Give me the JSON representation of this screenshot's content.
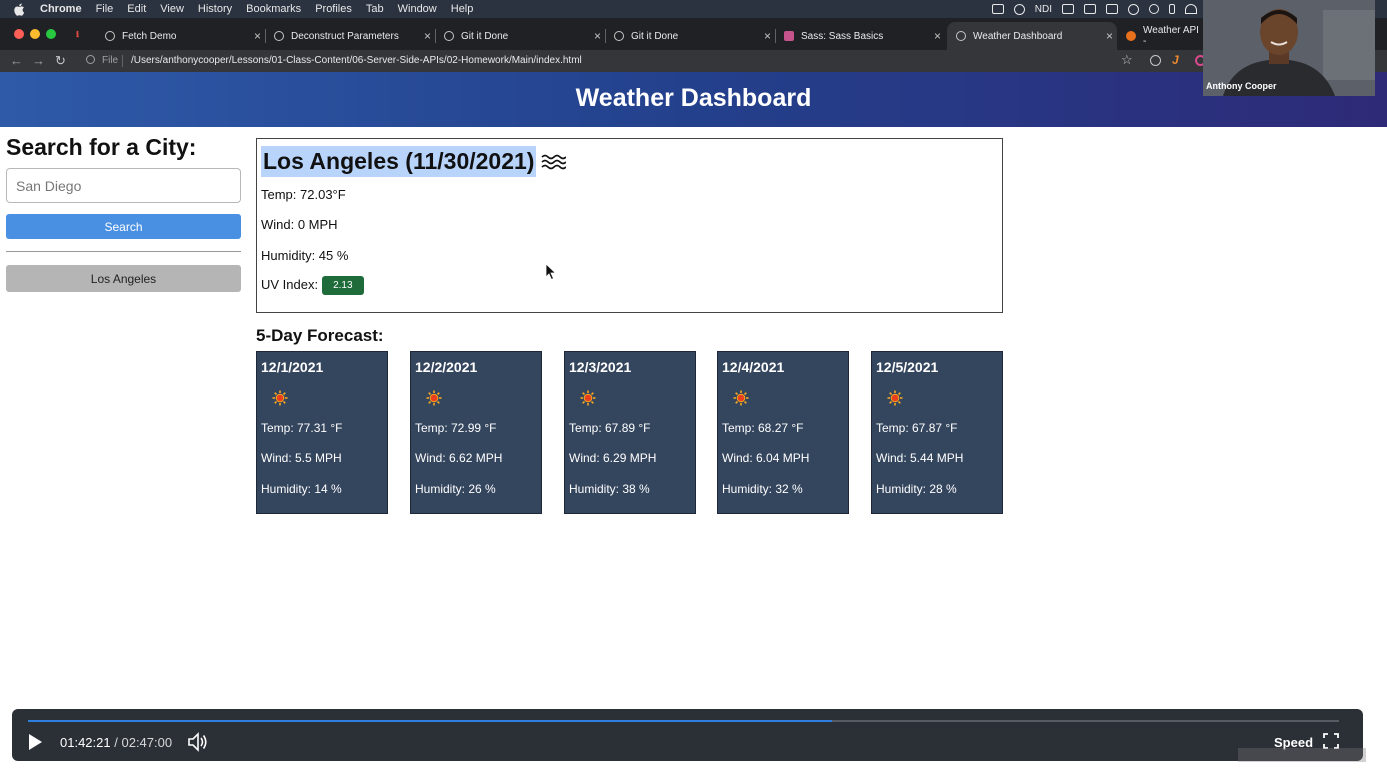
{
  "menubar": {
    "app": "Chrome",
    "items": [
      "File",
      "Edit",
      "View",
      "History",
      "Bookmarks",
      "Profiles",
      "Tab",
      "Window",
      "Help"
    ],
    "status_text": "NDI"
  },
  "tabs": [
    {
      "label": "Fetch Demo"
    },
    {
      "label": "Deconstruct Parameters"
    },
    {
      "label": "Git it Done"
    },
    {
      "label": "Git it Done"
    },
    {
      "label": "Sass: Sass Basics"
    },
    {
      "label": "Weather Dashboard",
      "active": true
    },
    {
      "label": "Weather API - "
    }
  ],
  "address": {
    "scheme_label": "File",
    "url": "/Users/anthonycooper/Lessons/01-Class-Content/06-Server-Side-APIs/02-Homework/Main/index.html"
  },
  "page": {
    "header_title": "Weather Dashboard"
  },
  "sidebar": {
    "title": "Search for a City:",
    "search_placeholder": "San Diego",
    "search_button": "Search",
    "history": [
      "Los Angeles"
    ]
  },
  "current": {
    "heading": "Los Angeles (11/30/2021)",
    "icon": "haze-icon",
    "temp": "Temp: 72.03°F",
    "wind": "Wind: 0 MPH",
    "humidity": "Humidity: 45 %",
    "uv_label": "UV Index:",
    "uv_value": "2.13",
    "uv_color": "#1f6b3a"
  },
  "forecast": {
    "title": "5-Day Forecast:",
    "days": [
      {
        "date": "12/1/2021",
        "icon": "sun-icon",
        "temp": "Temp: 77.31 °F",
        "wind": "Wind: 5.5 MPH",
        "humidity": "Humidity: 14 %"
      },
      {
        "date": "12/2/2021",
        "icon": "sun-icon",
        "temp": "Temp: 72.99 °F",
        "wind": "Wind: 6.62 MPH",
        "humidity": "Humidity: 26 %"
      },
      {
        "date": "12/3/2021",
        "icon": "sun-icon",
        "temp": "Temp: 67.89 °F",
        "wind": "Wind: 6.29 MPH",
        "humidity": "Humidity: 38 %"
      },
      {
        "date": "12/4/2021",
        "icon": "sun-icon",
        "temp": "Temp: 68.27 °F",
        "wind": "Wind: 6.04 MPH",
        "humidity": "Humidity: 32 %"
      },
      {
        "date": "12/5/2021",
        "icon": "sun-icon",
        "temp": "Temp: 67.87 °F",
        "wind": "Wind: 5.44 MPH",
        "humidity": "Humidity: 28 %"
      }
    ],
    "card_color": "#34455e"
  },
  "webcam": {
    "name": "Anthony Cooper"
  },
  "player": {
    "current_time": "01:42:21",
    "separator": "/",
    "duration": "02:47:00",
    "progress_fraction": 0.613,
    "speed_label": "Speed",
    "accent_color": "#2f7fe0"
  }
}
